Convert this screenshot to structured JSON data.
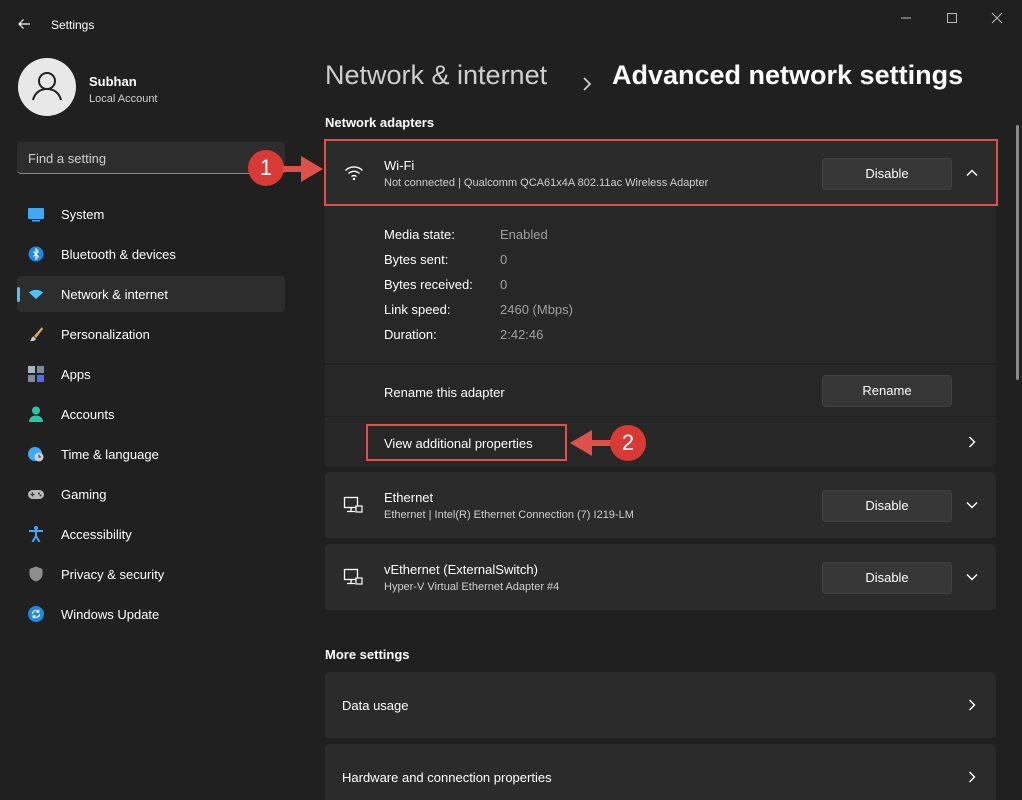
{
  "window": {
    "title": "Settings",
    "back_icon": "back-arrow-icon",
    "controls": [
      "minimize-icon",
      "maximize-icon",
      "close-icon"
    ]
  },
  "user": {
    "name": "Subhan",
    "account_type": "Local Account"
  },
  "search": {
    "placeholder": "Find a setting"
  },
  "sidebar": {
    "items": [
      {
        "label": "System",
        "icon": "system-icon",
        "active": false
      },
      {
        "label": "Bluetooth & devices",
        "icon": "bluetooth-icon",
        "active": false
      },
      {
        "label": "Network & internet",
        "icon": "wifi-icon",
        "active": true
      },
      {
        "label": "Personalization",
        "icon": "brush-icon",
        "active": false
      },
      {
        "label": "Apps",
        "icon": "apps-icon",
        "active": false
      },
      {
        "label": "Accounts",
        "icon": "person-icon",
        "active": false
      },
      {
        "label": "Time & language",
        "icon": "globe-clock-icon",
        "active": false
      },
      {
        "label": "Gaming",
        "icon": "gamepad-icon",
        "active": false
      },
      {
        "label": "Accessibility",
        "icon": "accessibility-icon",
        "active": false
      },
      {
        "label": "Privacy & security",
        "icon": "shield-icon",
        "active": false
      },
      {
        "label": "Windows Update",
        "icon": "update-icon",
        "active": false
      }
    ]
  },
  "breadcrumb": {
    "parent": "Network & internet",
    "current": "Advanced network settings"
  },
  "network_adapters": {
    "title": "Network adapters",
    "wifi": {
      "name": "Wi-Fi",
      "status": "Not connected | Qualcomm QCA61x4A 802.11ac Wireless Adapter",
      "button": "Disable",
      "details": [
        {
          "label": "Media state:",
          "value": "Enabled"
        },
        {
          "label": "Bytes sent:",
          "value": "0"
        },
        {
          "label": "Bytes received:",
          "value": "0"
        },
        {
          "label": "Link speed:",
          "value": "2460 (Mbps)"
        },
        {
          "label": "Duration:",
          "value": "2:42:46"
        }
      ],
      "rename_label": "Rename this adapter",
      "rename_button": "Rename",
      "view_properties": "View additional properties"
    },
    "ethernet": {
      "name": "Ethernet",
      "status": "Ethernet | Intel(R) Ethernet Connection (7) I219-LM",
      "button": "Disable"
    },
    "vethernet": {
      "name": "vEthernet (ExternalSwitch)",
      "status": "Hyper-V Virtual Ethernet Adapter #4",
      "button": "Disable"
    }
  },
  "more_settings": {
    "title": "More settings",
    "items": [
      "Data usage",
      "Hardware and connection properties"
    ]
  },
  "annotations": [
    "1",
    "2"
  ],
  "colors": {
    "background": "#202020",
    "card": "#2b2b2b",
    "accent": "#4cc2ff",
    "annotation": "#e0504a"
  }
}
